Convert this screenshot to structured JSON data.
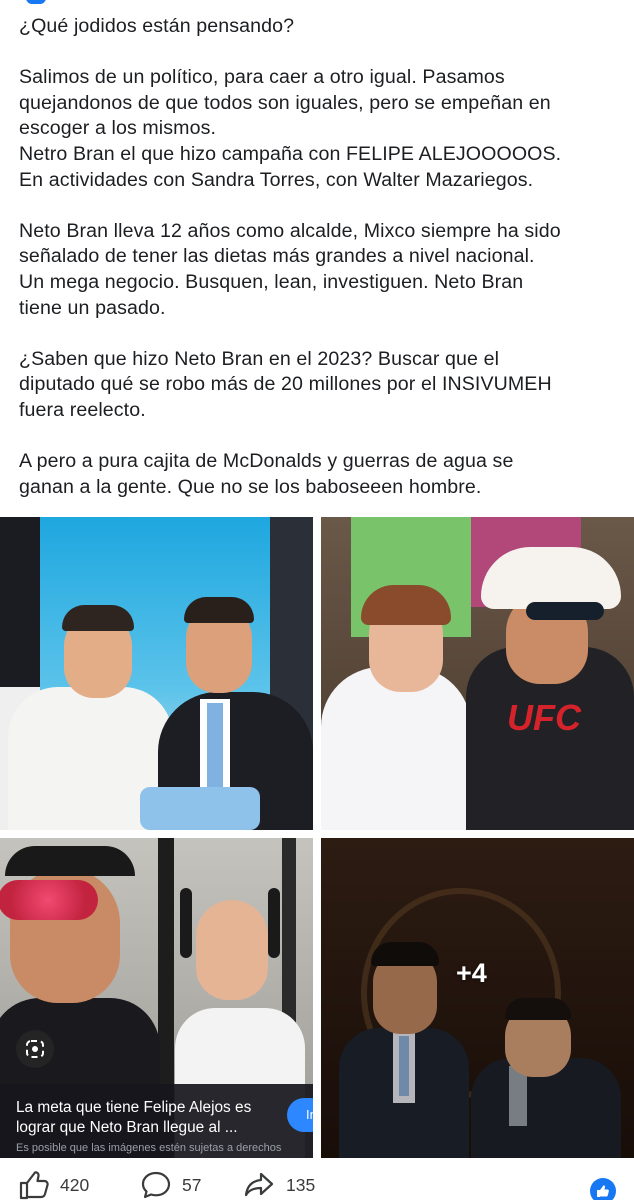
{
  "post": {
    "paragraphs": [
      [
        "¿Qué jodidos están pensando?"
      ],
      [
        "Salimos de un político, para caer a otro igual. Pasamos",
        "quejandonos de que todos son iguales, pero se empeñan en",
        "escoger a los mismos.",
        "Netro Bran el que hizo campaña con FELIPE ALEJOOOOOS.",
        "En actividades con Sandra Torres, con Walter Mazariegos."
      ],
      [
        "Neto Bran lleva 12 años como alcalde, Mixco siempre ha sido",
        "señalado de tener las dietas más grandes a nivel nacional.",
        "Un mega negocio. Busquen, lean, investiguen. Neto Bran",
        "tiene un pasado."
      ],
      [
        "¿Saben que hizo Neto Bran en el 2023? Buscar que el",
        "diputado qué se robo más de 20 millones por el INSIVUMEH",
        "fuera reelecto."
      ],
      [
        "A pero a pura cajita de McDonalds y guerras de agua se",
        "ganan a la gente. Que no se los baboseeen hombre."
      ]
    ]
  },
  "photos": {
    "more_count": "+4",
    "tile3_badge_text": "UFC",
    "caption": {
      "line1": "La meta que tiene Felipe Alejos es",
      "line2": "lograr que Neto Bran llegue al ...",
      "note": "Es posible que las imágenes estén sujetas a derechos",
      "button": "In"
    }
  },
  "reactions": {
    "likes": "420",
    "comments": "57",
    "shares": "135"
  },
  "colors": {
    "accent": "#1877f2",
    "caption_bg": "#16161c"
  }
}
